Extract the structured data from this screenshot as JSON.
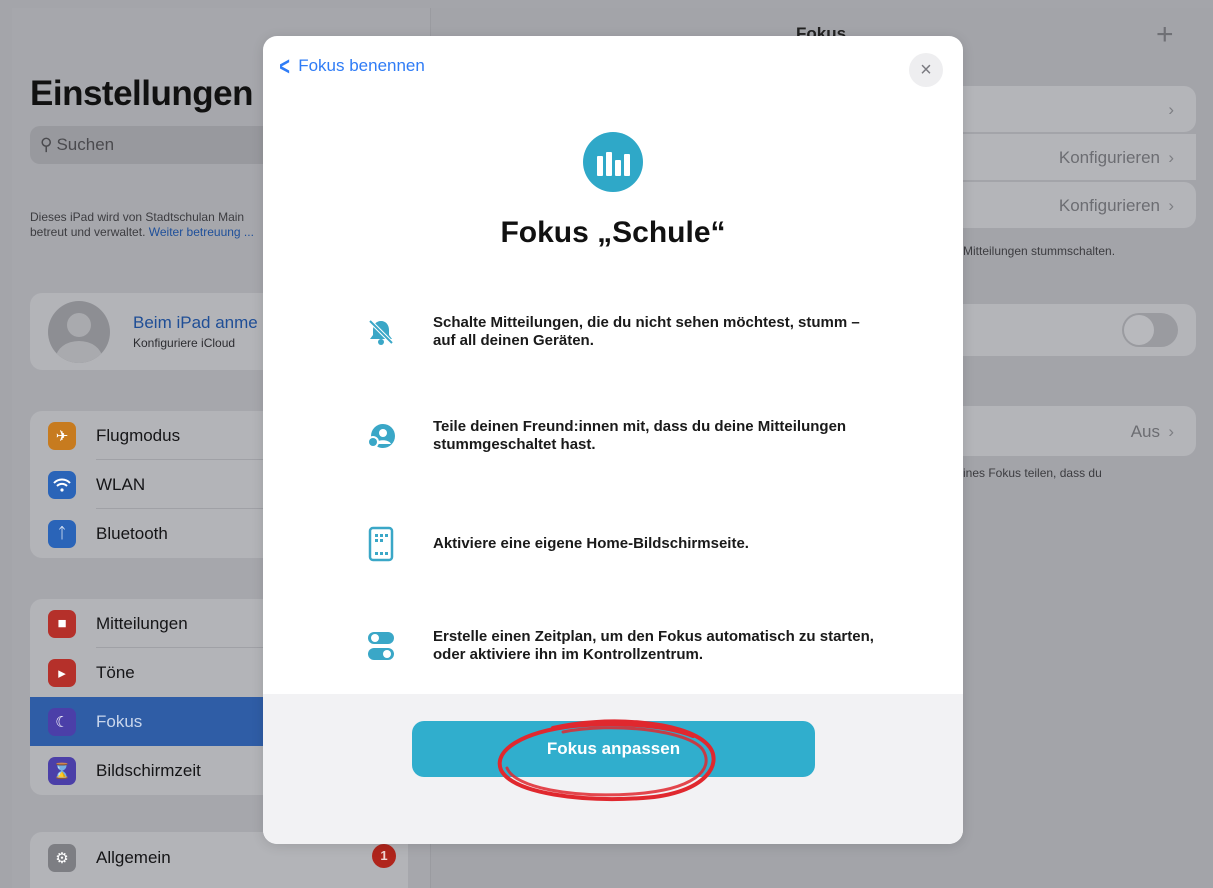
{
  "sidebar": {
    "title": "Einstellungen",
    "search_placeholder": "Suchen",
    "managed_note": "Dieses iPad wird von Stadtschulan Main betreut und verwaltet.",
    "managed_link": "Weiter betreuung ...",
    "profile": {
      "title": "Beim iPad anme",
      "subtitle": "Konfiguriere iCloud"
    },
    "group1": [
      {
        "label": "Flugmodus",
        "icon": "airplane-icon",
        "color": "#c77b1f"
      },
      {
        "label": "WLAN",
        "icon": "wifi-icon",
        "color": "#2a64b8"
      },
      {
        "label": "Bluetooth",
        "icon": "bluetooth-icon",
        "color": "#2a64b8"
      }
    ],
    "group2": [
      {
        "label": "Mitteilungen",
        "icon": "notifications-icon",
        "color": "#b5302a"
      },
      {
        "label": "Töne",
        "icon": "sounds-icon",
        "color": "#b5302a"
      },
      {
        "label": "Fokus",
        "icon": "moon-icon",
        "color": "#4b3fa8",
        "selected": true
      },
      {
        "label": "Bildschirmzeit",
        "icon": "hourglass-icon",
        "color": "#4b3fa8"
      }
    ],
    "group3": [
      {
        "label": "Allgemein",
        "icon": "gear-icon",
        "color": "#7d7e83",
        "badge": "1"
      }
    ]
  },
  "detail": {
    "title": "Fokus",
    "row_configure_1": "Konfigurieren",
    "row_configure_2": "Konfigurieren",
    "mute_note": "Mitteilungen stummschalten.",
    "row_share_value": "Aus",
    "share_note": "ines Fokus teilen, dass du"
  },
  "modal": {
    "back_label": "Fokus benennen",
    "close_label": "×",
    "heading": "Fokus „Schule“",
    "features": [
      {
        "text": "Schalte Mitteilungen, die du nicht sehen möchtest, stumm – auf all deinen Geräten.",
        "icon": "bell-slash-icon"
      },
      {
        "text": "Teile deinen Freund:innen mit, dass du deine Mitteilungen stummgeschaltet hast.",
        "icon": "focus-status-icon"
      },
      {
        "text": "Aktiviere eine eigene Home-Bildschirmseite.",
        "icon": "home-screen-icon"
      },
      {
        "text": "Erstelle einen Zeitplan, um den Fokus automatisch zu starten, oder aktiviere ihn im Kontrollzentrum.",
        "icon": "toggles-icon"
      }
    ],
    "cta_label": "Fokus anpassen"
  },
  "colors": {
    "accent": "#30aecd",
    "link": "#2f7cf6",
    "annotation": "#e0282e"
  }
}
